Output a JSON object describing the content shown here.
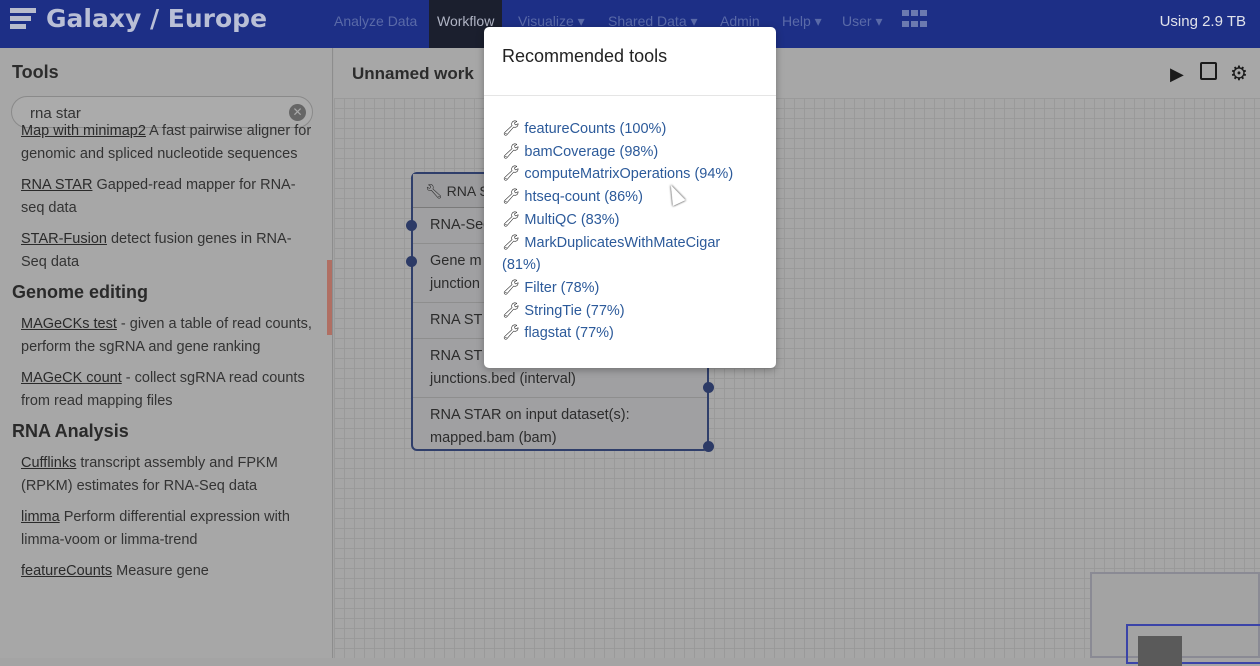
{
  "header": {
    "brand": "Galaxy / Europe",
    "nav": [
      "Analyze Data",
      "Workflow",
      "Visualize ▾",
      "Shared Data ▾",
      "Admin",
      "Help ▾",
      "User ▾"
    ],
    "active": "Workflow",
    "usage": "Using 2.9 TB",
    "color": "#1d2f86"
  },
  "sidebar": {
    "title": "Tools",
    "search_value": "rna star",
    "items": [
      {
        "type": "tool",
        "name": "Map with minimap2",
        "desc": " A fast pairwise aligner for genomic and spliced nucleotide sequences"
      },
      {
        "type": "tool",
        "name": "RNA STAR",
        "desc": " Gapped-read mapper for RNA-seq data"
      },
      {
        "type": "tool",
        "name": "STAR-Fusion",
        "desc": " detect fusion genes in RNA-Seq data"
      },
      {
        "type": "section",
        "name": "Genome editing"
      },
      {
        "type": "tool",
        "name": "MAGeCKs test",
        "desc": " - given a table of read counts, perform the sgRNA and gene ranking"
      },
      {
        "type": "tool",
        "name": "MAGeCK count",
        "desc": " - collect sgRNA read counts from read mapping files"
      },
      {
        "type": "section",
        "name": "RNA Analysis"
      },
      {
        "type": "tool",
        "name": "Cufflinks",
        "desc": " transcript assembly and FPKM (RPKM) estimates for RNA-Seq data"
      },
      {
        "type": "tool",
        "name": "limma",
        "desc": " Perform differential expression with limma-voom or limma-trend"
      },
      {
        "type": "tool",
        "name": "featureCounts",
        "desc": " Measure gene"
      }
    ]
  },
  "workflow": {
    "title": "Unnamed work",
    "icons": [
      "play-icon",
      "save-icon",
      "gear-icon"
    ]
  },
  "node": {
    "title": "RNA S",
    "rows": [
      "RNA-Sec",
      "Gene m\njunction",
      "RNA ST",
      "RNA ST\njunctions.bed (interval)",
      "RNA STAR on input dataset(s):\nmapped.bam (bam)"
    ]
  },
  "popup": {
    "title": "Recommended tools",
    "tools": [
      "featureCounts (100%)",
      "bamCoverage (98%)",
      "computeMatrixOperations (94%)",
      "htseq-count (86%)",
      "MultiQC (83%)",
      "MarkDuplicatesWithMateCigar (81%)",
      "Filter (78%)",
      "StringTie (77%)",
      "flagstat (77%)"
    ]
  }
}
